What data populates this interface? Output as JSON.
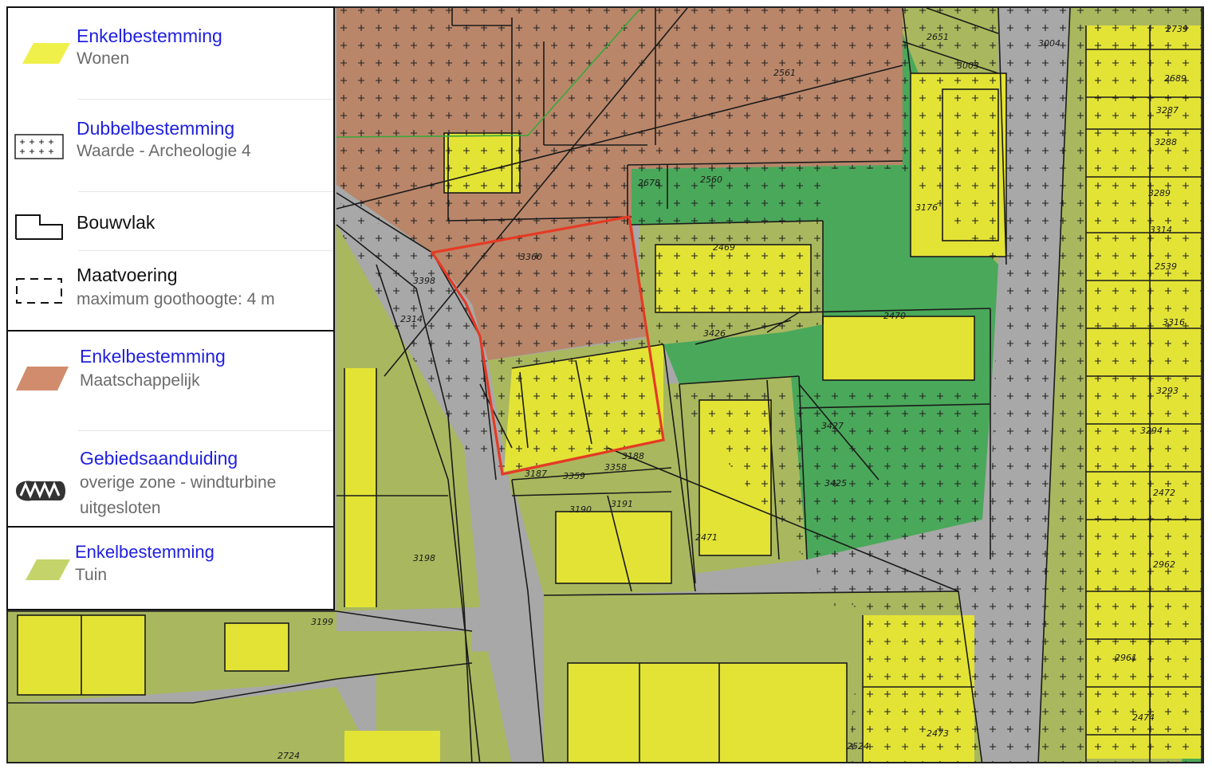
{
  "legend": {
    "items": [
      {
        "key": "wonen",
        "title": "Enkelbestemming",
        "subtitle": "Wonen",
        "swatch": "yellow-parallelogram-icon",
        "color": "#f0f04a"
      },
      {
        "key": "archeologie",
        "title": "Dubbelbestemming",
        "subtitle": "Waarde - Archeologie 4",
        "swatch": "cross-hatch-icon"
      },
      {
        "key": "bouwvlak",
        "title": "Bouwvlak",
        "swatch": "bouwvlak-outline-icon"
      },
      {
        "key": "maatvoering",
        "title": "Maatvoering",
        "subtitle": "maximum goothoogte: 4 m",
        "swatch": "dashed-box-icon"
      },
      {
        "key": "maatschappelijk",
        "title": "Enkelbestemming",
        "subtitle": "Maatschappelijk",
        "swatch": "brown-parallelogram-icon",
        "color": "#d08c6c"
      },
      {
        "key": "windturbine",
        "title": "Gebiedsaanduiding",
        "subtitle_line1": "overige zone - windturbine",
        "subtitle_line2": "uitgesloten",
        "swatch": "zigzag-zone-icon"
      },
      {
        "key": "tuin",
        "title": "Enkelbestemming",
        "subtitle": "Tuin",
        "swatch": "green-parallelogram-icon",
        "color": "#c4d46a"
      }
    ]
  },
  "map": {
    "parcel_numbers": [
      "2651",
      "3004",
      "2739",
      "3003",
      "2561",
      "2689",
      "3287",
      "3288",
      "2678",
      "2560",
      "3289",
      "3176",
      "3314",
      "2469",
      "3360",
      "2539",
      "3398",
      "2314",
      "2470",
      "3316",
      "3426",
      "3293",
      "3427",
      "3294",
      "3188",
      "3187",
      "3359",
      "3358",
      "3425",
      "2472",
      "3190",
      "3191",
      "2471",
      "3198",
      "2962",
      "2961",
      "3199",
      "2474",
      "2724",
      "2524",
      "2473"
    ],
    "colors": {
      "wonen": "#e3e336",
      "tuin": "#a9b85e",
      "maatschappelijk": "#b9866a",
      "groen": "#4aa85a",
      "verkeer": "#a8a8a8",
      "plangebied": "#e53a24"
    }
  }
}
